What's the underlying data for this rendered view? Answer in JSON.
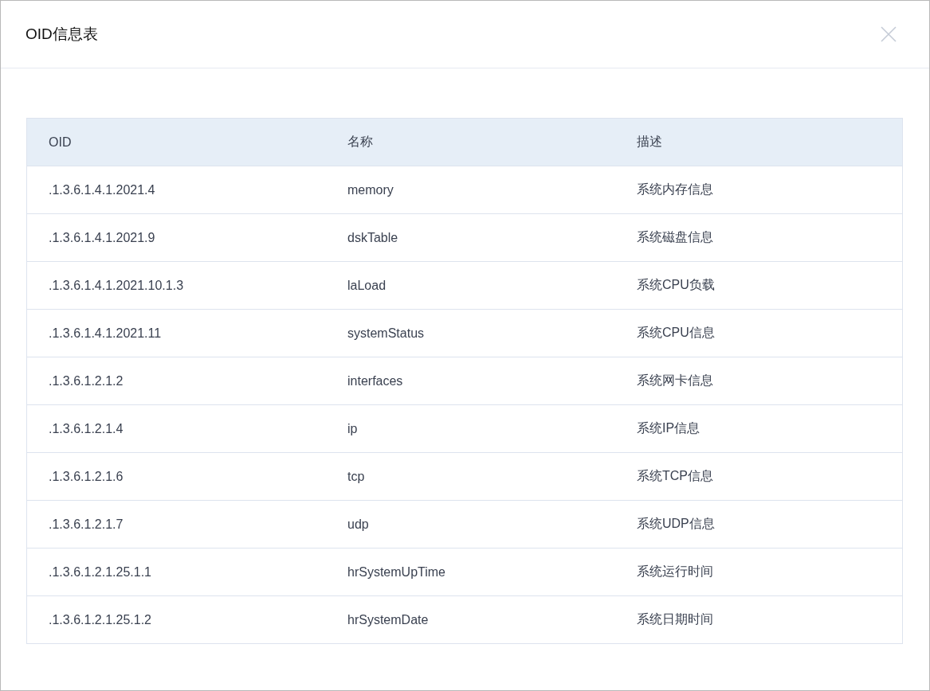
{
  "dialog": {
    "title": "OID信息表"
  },
  "table": {
    "columns": [
      "OID",
      "名称",
      "描述"
    ],
    "rows": [
      [
        ".1.3.6.1.4.1.2021.4",
        "memory",
        "系统内存信息"
      ],
      [
        ".1.3.6.1.4.1.2021.9",
        "dskTable",
        "系统磁盘信息"
      ],
      [
        ".1.3.6.1.4.1.2021.10.1.3",
        "laLoad",
        "系统CPU负载"
      ],
      [
        ".1.3.6.1.4.1.2021.11",
        "systemStatus",
        "系统CPU信息"
      ],
      [
        ".1.3.6.1.2.1.2",
        "interfaces",
        "系统网卡信息"
      ],
      [
        ".1.3.6.1.2.1.4",
        "ip",
        "系统IP信息"
      ],
      [
        ".1.3.6.1.2.1.6",
        "tcp",
        "系统TCP信息"
      ],
      [
        ".1.3.6.1.2.1.7",
        "udp",
        "系统UDP信息"
      ],
      [
        ".1.3.6.1.2.1.25.1.1",
        "hrSystemUpTime",
        "系统运行时间"
      ],
      [
        ".1.3.6.1.2.1.25.1.2",
        "hrSystemDate",
        "系统日期时间"
      ]
    ]
  }
}
